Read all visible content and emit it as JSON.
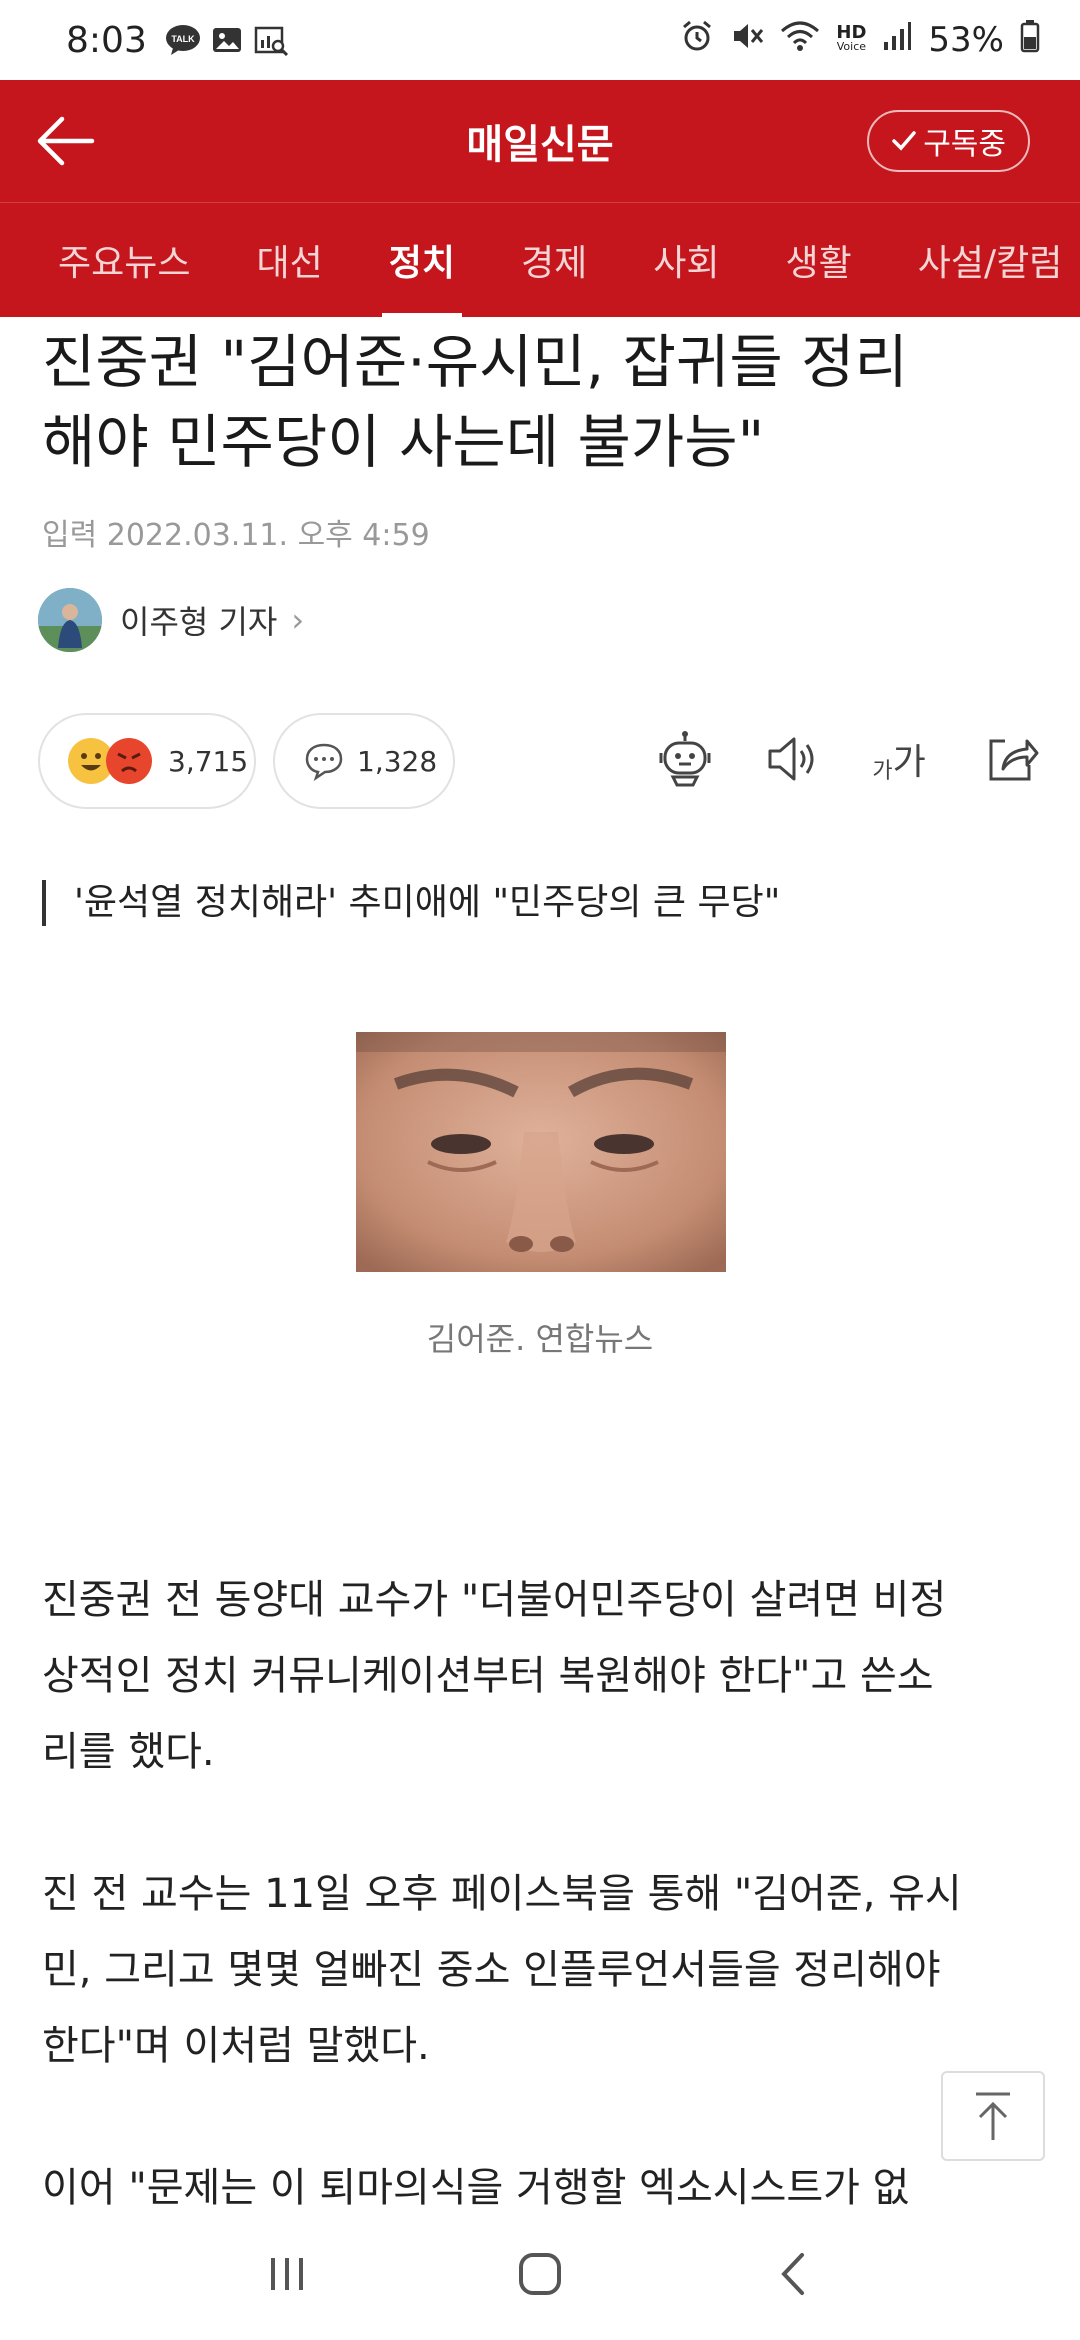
{
  "status": {
    "time": "8:03",
    "talk_badge": "TALK",
    "battery": "53%",
    "hd_label": "HD",
    "voice_label": "Voice"
  },
  "header": {
    "title": "매일신문",
    "subscribe_label": "구독중"
  },
  "tabs": [
    {
      "label": "주요뉴스",
      "active": false
    },
    {
      "label": "대선",
      "active": false
    },
    {
      "label": "정치",
      "active": true
    },
    {
      "label": "경제",
      "active": false
    },
    {
      "label": "사회",
      "active": false
    },
    {
      "label": "생활",
      "active": false
    },
    {
      "label": "사설/칼럼",
      "active": false
    }
  ],
  "article": {
    "headline_line1": "진중권 \"김어준·유시민, 잡귀들 정리",
    "headline_line2": "해야 민주당이 사는데 불가능\"",
    "dateline": "입력 2022.03.11. 오후 4:59",
    "author": "이주형 기자",
    "reactions_count": "3,715",
    "comments_count": "1,328",
    "font_toggle_small": "가",
    "font_toggle_large": "가",
    "subheadline": "'윤석열 정치해라' 추미애에 \"민주당의 큰 무당\"",
    "photo_caption": "김어준. 연합뉴스",
    "paragraphs": [
      [
        "진중권 전 동양대 교수가 \"더불어민주당이 살려면 비정",
        "상적인 정치 커뮤니케이션부터 복원해야 한다\"고 쓴소",
        "리를 했다."
      ],
      [
        "진 전 교수는 11일 오후 페이스북을 통해 \"김어준, 유시",
        "민, 그리고 몇몇 얼빠진 중소 인플루언서들을 정리해야",
        "한다\"며 이처럼 말했다."
      ],
      [
        "이어 \"문제는 이 퇴마의식을 거행할 엑소시스트가 없"
      ]
    ]
  },
  "colors": {
    "brand_red": "#c4161c",
    "text": "#222222",
    "muted": "#999999"
  }
}
